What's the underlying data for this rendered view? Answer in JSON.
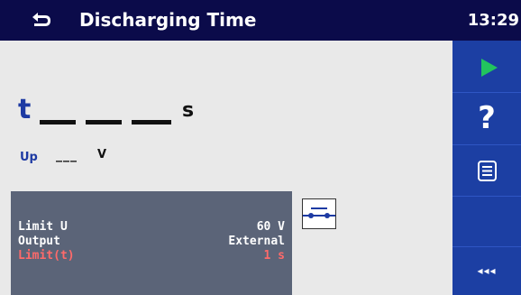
{
  "titlebar": {
    "title": "Discharging Time",
    "clock": "13:29",
    "back_icon": "back-arrow-icon"
  },
  "result": {
    "t_label": "t",
    "t_unit": "s",
    "up_label": "Up",
    "up_value": "___",
    "up_unit": "V"
  },
  "parameters": [
    {
      "label": "Limit U",
      "value": "60 V",
      "highlight": false
    },
    {
      "label": "Output",
      "value": "External",
      "highlight": false
    },
    {
      "label": "Limit(t)",
      "value": "1 s",
      "highlight": true
    }
  ],
  "sidebar": {
    "start_icon": "play-icon",
    "help_label": "?",
    "help_icon": "help-icon",
    "list_icon": "list-icon",
    "more_label": "◂◂◂"
  },
  "colors": {
    "titlebar": "#0b0b4a",
    "sidebar": "#1c3fa3",
    "play": "#22c55e",
    "label_blue": "#1d3aa3",
    "param_panel": "#5b6478",
    "limit_highlight": "#ff6a6a"
  }
}
